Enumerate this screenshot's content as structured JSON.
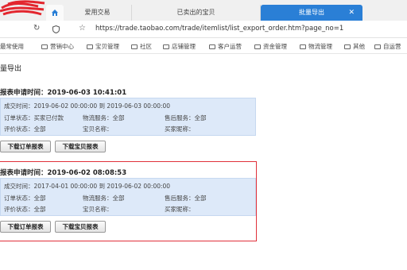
{
  "browser": {
    "tabs": [
      {
        "label": "爱用交易"
      },
      {
        "label": "已卖出的宝贝"
      },
      {
        "label": "批量导出"
      }
    ],
    "url": "https://trade.taobao.com/trade/itemlist/list_export_order.htm?page_no=1",
    "bookmarks": [
      "最常使用",
      "营销中心",
      "宝贝管理",
      "社区",
      "店铺管理",
      "客户运营",
      "资金管理",
      "物流管理",
      "其他",
      "自运营"
    ]
  },
  "page": {
    "title": "量导出",
    "records": [
      {
        "request_time": "报表申请时间：2019-06-03 10:41:01",
        "deal_time": "成交时间：2019-06-02 00:00:00 到 2019-06-03 00:00:00",
        "order_status": "订单状态：买家已付款",
        "logistics": "物流服务：全部",
        "after_sale": "售后服务：全部",
        "rating": "评价状态：全部",
        "item_name": "宝贝名称：",
        "buyer_nick": "买家昵称：",
        "btn_order": "下载订单报表",
        "btn_item": "下载宝贝报表"
      },
      {
        "request_time": "报表申请时间：2019-06-02 08:08:53",
        "deal_time": "成交时间：2017-04-01 00:00:00 到 2019-06-02 00:00:00",
        "order_status": "订单状态：全部",
        "logistics": "物流服务：全部",
        "after_sale": "售后服务：全部",
        "rating": "评价状态：全部",
        "item_name": "宝贝名称：",
        "buyer_nick": "买家昵称：",
        "btn_order": "下载订单报表",
        "btn_item": "下载宝贝报表"
      }
    ]
  },
  "icons": {
    "home": "home-icon",
    "close": "close-icon",
    "reload": "reload-icon",
    "shield": "shield-icon",
    "star": "star-icon",
    "folder": "folder-icon"
  },
  "colors": {
    "active_tab": "#2a7fd6",
    "info_bg": "#dde9f9",
    "highlight": "#e0303a"
  }
}
